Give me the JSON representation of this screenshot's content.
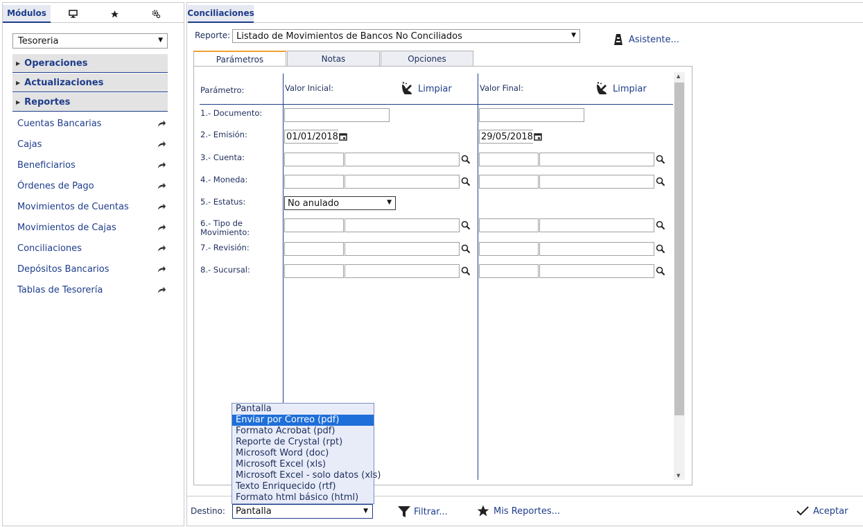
{
  "sidebar": {
    "tabs": {
      "modulos": "Módulos",
      "monitor_icon": "monitor-icon",
      "star_icon": "star-icon",
      "gear_icon": "gear-icon"
    },
    "module_selected": "Tesoreria",
    "sections": [
      "Operaciones",
      "Actualizaciones",
      "Reportes"
    ],
    "items": [
      "Cuentas Bancarias",
      "Cajas",
      "Beneficiarios",
      "Órdenes de Pago",
      "Movimientos de Cuentas",
      "Movimientos de Cajas",
      "Conciliaciones",
      "Depósitos Bancarios",
      "Tablas de Tesorería"
    ]
  },
  "main": {
    "tab_title": "Conciliaciones",
    "report_label": "Reporte:",
    "report_selected": "Listado de Movimientos de Bancos No Conciliados",
    "asistente": "Asistente...",
    "subtabs": [
      "Parámetros",
      "Notas",
      "Opciones"
    ],
    "params": {
      "col_param": "Parámetro:",
      "col_initial": "Valor Inicial:",
      "col_final": "Valor Final:",
      "clear": "Limpiar",
      "rows": [
        "1.- Documento:",
        "2.- Emisión:",
        "3.- Cuenta:",
        "4.- Moneda:",
        "5.- Estatus:",
        "6.- Tipo de Movimiento:",
        "7.- Revisión:",
        "8.- Sucursal:"
      ],
      "date_initial": "01/01/2018",
      "date_final": "29/05/2018",
      "status_selected": "No anulado"
    },
    "bottom": {
      "dest_label": "Destino:",
      "dest_selected": "Pantalla",
      "filtrar": "Filtrar...",
      "mis_reportes": "Mis Reportes...",
      "aceptar": "Aceptar"
    },
    "dest_options": [
      "Pantalla",
      "Enviar por Correo (pdf)",
      "Formato Acrobat (pdf)",
      "Reporte de Crystal (rpt)",
      "Microsoft Word (doc)",
      "Microsoft Excel (xls)",
      "Microsoft Excel - solo datos (xls)",
      "Texto Enriquecido (rtf)",
      "Formato html básico (html)"
    ],
    "dest_highlighted": "Enviar por Correo (pdf)"
  },
  "colors": {
    "accent": "#1d3c8a",
    "highlight": "#1e6fd9",
    "tab_active_border": "#f0a030"
  }
}
